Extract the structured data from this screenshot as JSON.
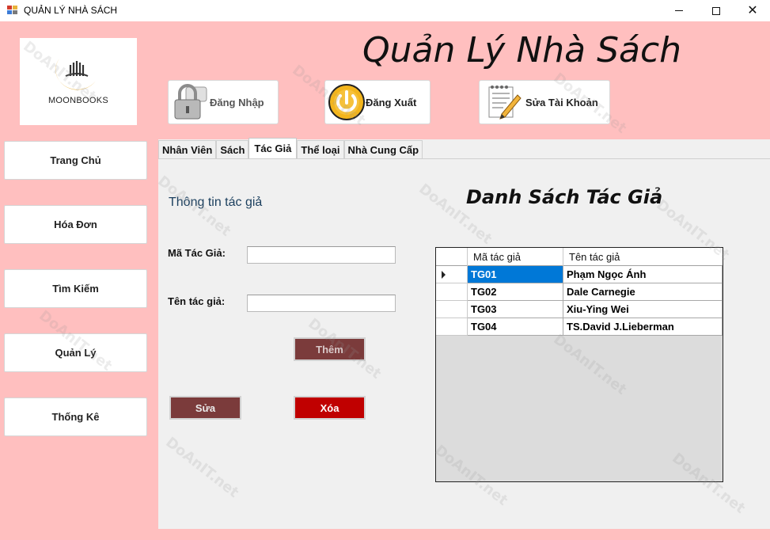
{
  "window": {
    "title": "QUẢN LÝ NHÀ SÁCH",
    "minimize": "—",
    "maximize": "",
    "close": "✕"
  },
  "logo": {
    "text": "MOONBOOKS",
    "icon": "book-moon-logo"
  },
  "header": {
    "title": "Quản Lý Nhà Sách"
  },
  "top_buttons": {
    "login": {
      "label": "Đăng Nhập",
      "icon": "lock-icon"
    },
    "logout": {
      "label": "Đăng Xuất",
      "icon": "power-icon"
    },
    "account": {
      "label": "Sửa Tài Khoản",
      "icon": "notepad-pencil-icon"
    }
  },
  "sidebar": {
    "items": [
      {
        "label": "Trang Chủ"
      },
      {
        "label": "Hóa Đơn"
      },
      {
        "label": "Tìm Kiếm"
      },
      {
        "label": "Quản Lý"
      },
      {
        "label": "Thống Kê"
      }
    ]
  },
  "tabs": [
    {
      "label": "Nhân Viên",
      "active": false
    },
    {
      "label": "Sách",
      "active": false
    },
    {
      "label": "Tác Giả",
      "active": true
    },
    {
      "label": "Thể loại",
      "active": false
    },
    {
      "label": "Nhà Cung Cấp",
      "active": false
    }
  ],
  "form": {
    "section_title": "Thông tin tác giả",
    "author_id_label": "Mã Tác Giả:",
    "author_id_value": "",
    "author_name_label": "Tên tác giả:",
    "author_name_value": "",
    "add_button": "Thêm",
    "edit_button": "Sửa",
    "delete_button": "Xóa"
  },
  "list": {
    "title": "Danh Sách Tác Giả",
    "columns": [
      "Mã tác giả",
      "Tên tác giả"
    ],
    "rows": [
      {
        "id": "TG01",
        "name": "Phạm Ngọc Ánh"
      },
      {
        "id": "TG02",
        "name": "Dale Carnegie"
      },
      {
        "id": "TG03",
        "name": "Xiu-Ying Wei"
      },
      {
        "id": "TG04",
        "name": "TS.David J.Lieberman"
      }
    ],
    "selected_row": 0
  },
  "watermark": {
    "text": "DoAnIT.net"
  },
  "colors": {
    "background": "#ffbfbf",
    "add_button": "#7b3b3b",
    "edit_button": "#7b3b3b",
    "delete_button": "#c00000",
    "selection": "#0078d7"
  }
}
